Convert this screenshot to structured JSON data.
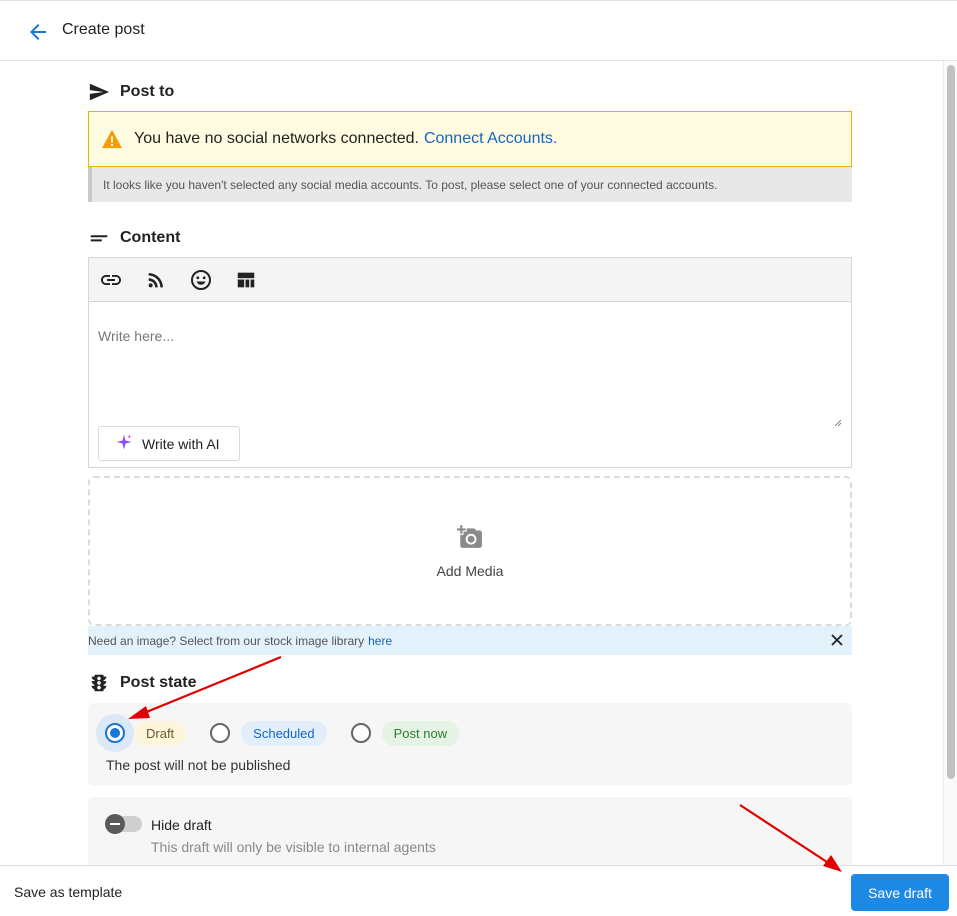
{
  "header": {
    "title": "Create post",
    "back_icon": "arrow-left-icon"
  },
  "post_to": {
    "heading": "Post to",
    "icon": "send-icon",
    "warning_text": "You have no social networks connected.",
    "warning_link": "Connect Accounts.",
    "info_text": "It looks like you haven't selected any social media accounts. To post, please select one of your connected accounts."
  },
  "content": {
    "heading": "Content",
    "icon": "short-text-icon",
    "toolbar": [
      "link-icon",
      "rss-icon",
      "emoji-icon",
      "template-icon"
    ],
    "placeholder": "Write here...",
    "value": "",
    "ai_button": "Write with AI"
  },
  "media": {
    "label": "Add Media",
    "stock_text": "Need an image? Select from our stock image library",
    "stock_link": "here"
  },
  "post_state": {
    "heading": "Post state",
    "icon": "traffic-light-icon",
    "options": [
      "Draft",
      "Scheduled",
      "Post now"
    ],
    "selected": "Draft",
    "description": "The post will not be published"
  },
  "hide_draft": {
    "title": "Hide draft",
    "subtitle": "This draft will only be visible to internal agents",
    "enabled": false
  },
  "footer": {
    "save_template": "Save as template",
    "save_draft": "Save draft"
  },
  "colors": {
    "accent": "#1e88e5",
    "warning_bg": "#fffbe0",
    "warning_border": "#e9b500",
    "annotation_arrow": "#e00000"
  }
}
